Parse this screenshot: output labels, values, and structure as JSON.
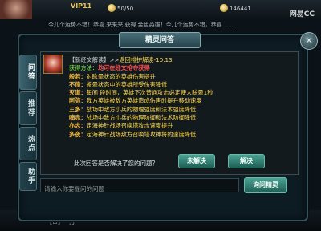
{
  "top": {
    "vip": "VIP11",
    "stamina": "50/50",
    "coins": "146441",
    "watermark": "网易CC",
    "marquee": "今儿个运势不错！恭喜 来来来 获得 金色英雄！今儿个运势不错，恭喜 ……"
  },
  "dialog": {
    "title": "精灵问答",
    "close": "×",
    "tabs": [
      "问答",
      "推荐",
      "热点",
      "助手"
    ]
  },
  "answer": {
    "header_prefix": "【新经文解读】>>",
    "header_link": "返回排护解读-10.13",
    "lines": [
      {
        "label": "获得方法：",
        "text": "均可在经文抢夺获得",
        "style": "red"
      },
      {
        "label": "般若：",
        "text": "对眩晕状态的英雄伤害提升",
        "style": "gold"
      },
      {
        "label": "不债：",
        "text": "鉴晕状态中的英雄所受伤害降低",
        "style": "gold"
      },
      {
        "label": "灭道：",
        "text": "每间  段时间，英雄下次普通攻击必定使人眩晕1秒",
        "style": "gold"
      },
      {
        "label": "阿弥：",
        "text": "我方英雄被敌方英雄造成伤害时提升移动速度",
        "style": "gold"
      },
      {
        "label": "三多：",
        "text": "战场中敌方小兵的物理强度和法术强度降低",
        "style": "gold"
      },
      {
        "label": "喃赤：",
        "text": "战场中敌方小兵的物理防御和法术防御降低",
        "style": "gold"
      },
      {
        "label": "亦志：",
        "text": "定海神针战场召唤塔攻击速度提升",
        "style": "gold"
      },
      {
        "label": "多夜：",
        "text": "定海神针战场敌方召唤塔攻神将的速度降低",
        "style": "gold"
      }
    ],
    "question": "此次回答是否解决了您的问题？",
    "btn_no": "未解决",
    "btn_yes": "解决"
  },
  "input": {
    "placeholder": "请输入你要提问的问题",
    "ask_button": "询问精灵"
  },
  "bottom": {
    "text": "【审】一刀"
  }
}
